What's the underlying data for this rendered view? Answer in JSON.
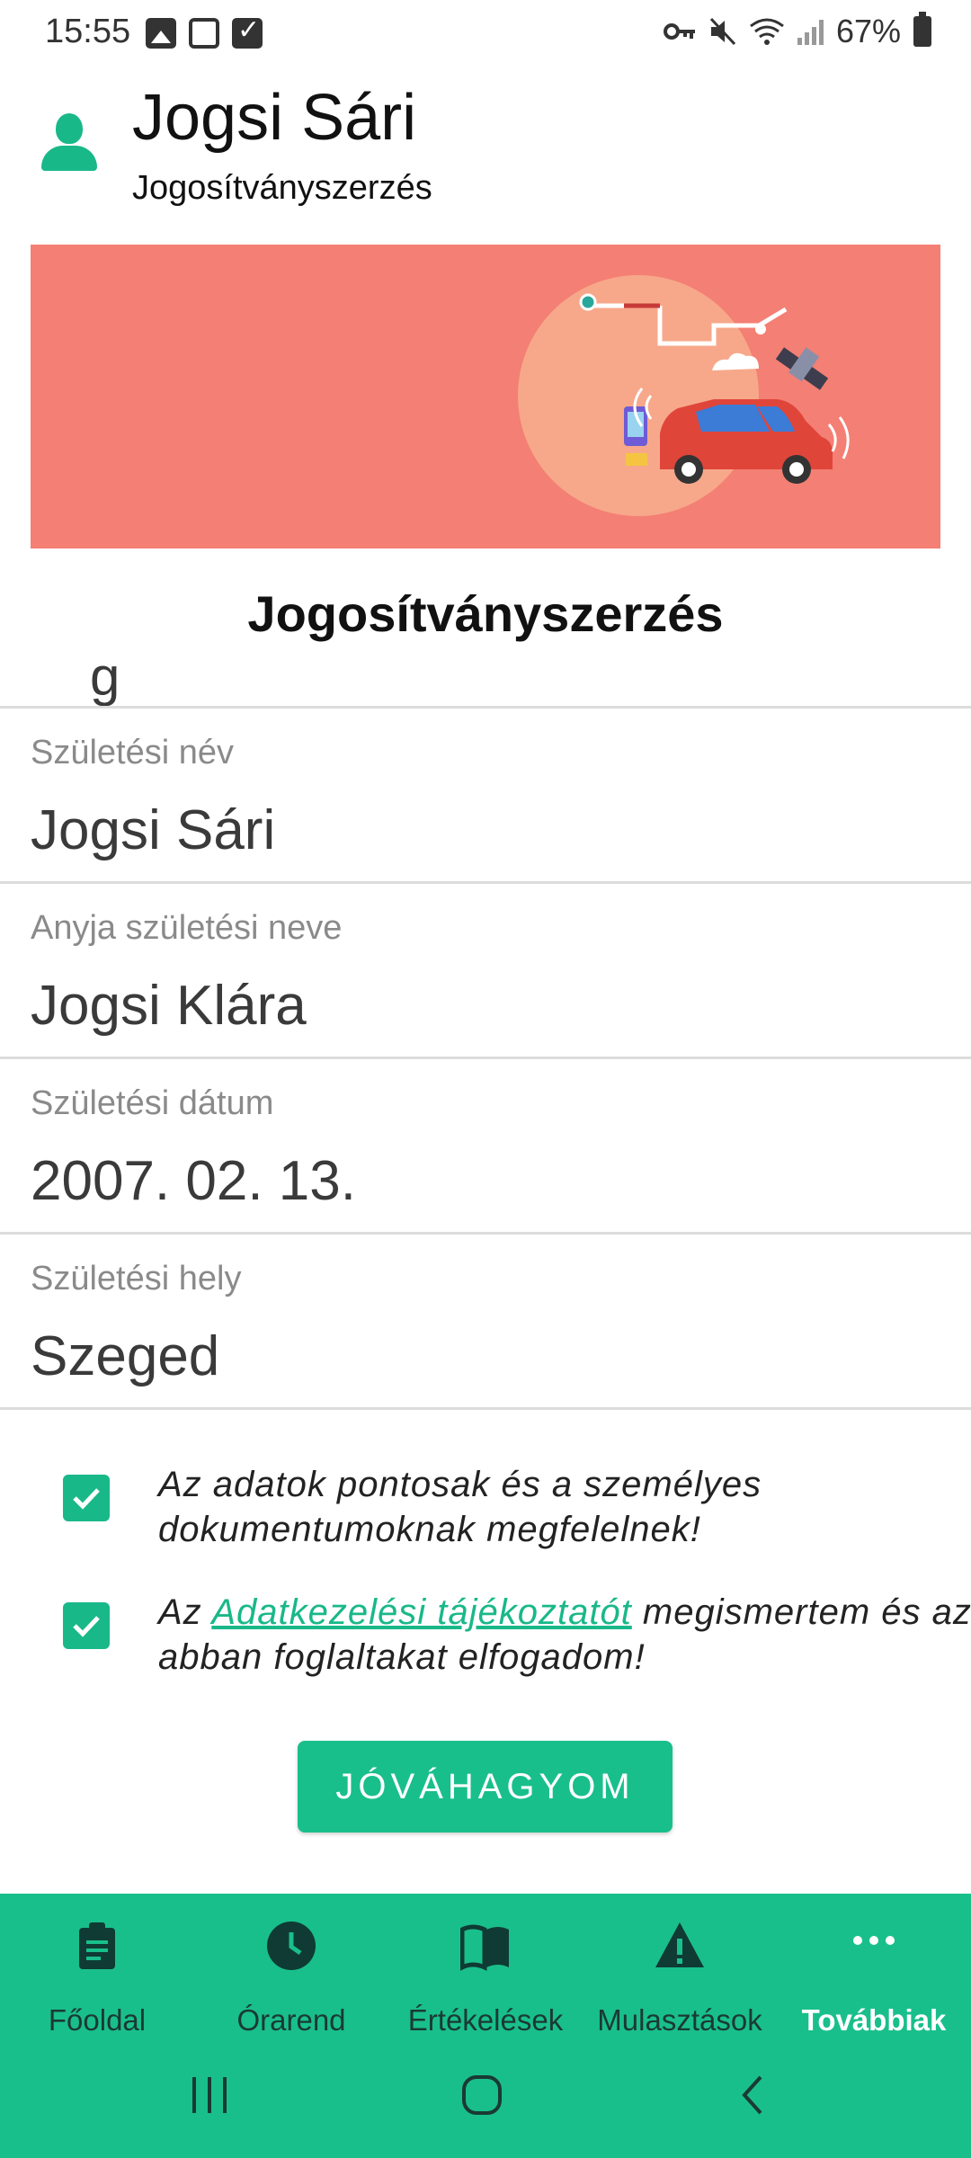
{
  "status_bar": {
    "time": "15:55",
    "battery": "67%"
  },
  "header": {
    "user_name": "Jogsi Sári",
    "course": "Jogosítványszerzés"
  },
  "page_title": "Jogosítványszerzés",
  "fields": [
    {
      "label": "Születési név",
      "value": "Jogsi Sári"
    },
    {
      "label": "Anyja születési neve",
      "value": "Jogsi Klára"
    },
    {
      "label": "Születési dátum",
      "value": "2007. 02. 13."
    },
    {
      "label": "Születési hely",
      "value": "Szeged"
    }
  ],
  "consents": {
    "accuracy": {
      "text": "Az adatok pontosak és a személyes dokumentumoknak megfelelnek!",
      "checked": true
    },
    "privacy": {
      "prefix": "Az ",
      "link": "Adatkezelési tájékoztatót",
      "suffix": " megismertem és az abban foglaltakat elfogadom!",
      "checked": true
    }
  },
  "approve_button": "JÓVÁHAGYOM",
  "bottom_nav": [
    {
      "label": "Főoldal",
      "icon": "clipboard-icon"
    },
    {
      "label": "Órarend",
      "icon": "clock-icon"
    },
    {
      "label": "Értékelések",
      "icon": "book-icon"
    },
    {
      "label": "Mulasztások",
      "icon": "warning-icon"
    },
    {
      "label": "Továbbiak",
      "icon": "more-icon",
      "active": true
    }
  ],
  "colors": {
    "accent": "#19bf8b",
    "banner": "#f47f74",
    "text": "#222222"
  }
}
